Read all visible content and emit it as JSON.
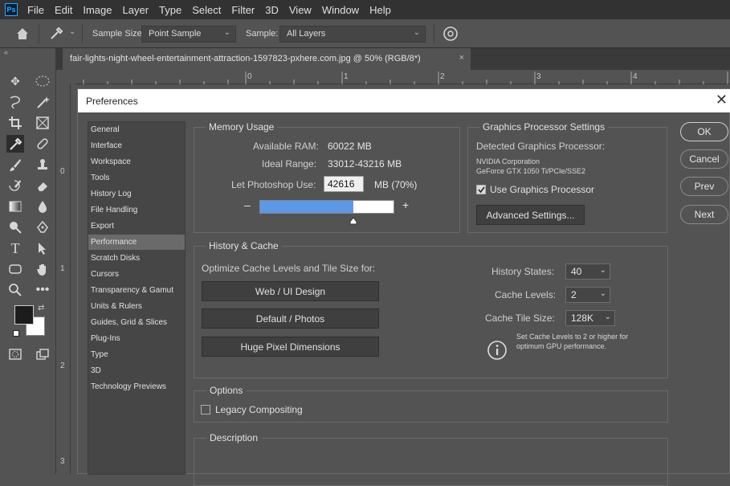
{
  "menubar": {
    "logo": "Ps",
    "items": [
      "File",
      "Edit",
      "Image",
      "Layer",
      "Type",
      "Select",
      "Filter",
      "3D",
      "View",
      "Window",
      "Help"
    ]
  },
  "options_bar": {
    "sample_size_label": "Sample Size:",
    "sample_size_value": "Point Sample",
    "sample_label": "Sample:",
    "sample_value": "All Layers"
  },
  "document_tab": {
    "title": "fair-lights-night-wheel-entertainment-attraction-1597823-pxhere.com.jpg @ 50% (RGB/8*)",
    "close": "×"
  },
  "rulers": {
    "horizontal": [
      "0",
      "1",
      "2",
      "3",
      "4"
    ],
    "vertical": [
      "0",
      "1",
      "2",
      "3"
    ]
  },
  "dialog": {
    "title": "Preferences",
    "close": "✕",
    "nav": [
      "General",
      "Interface",
      "Workspace",
      "Tools",
      "History Log",
      "File Handling",
      "Export",
      "Performance",
      "Scratch Disks",
      "Cursors",
      "Transparency & Gamut",
      "Units & Rulers",
      "Guides, Grid & Slices",
      "Plug-Ins",
      "Type",
      "3D",
      "Technology Previews"
    ],
    "selected_nav": "Performance",
    "memory": {
      "title": "Memory Usage",
      "available_label": "Available RAM:",
      "available_value": "60022 MB",
      "ideal_label": "Ideal Range:",
      "ideal_value": "33012-43216 MB",
      "let_label": "Let Photoshop Use:",
      "let_value": "42616",
      "let_suffix": "MB (70%)",
      "minus": "–",
      "plus": "+",
      "slider_fraction": 0.7
    },
    "gpu": {
      "title": "Graphics Processor Settings",
      "detected_label": "Detected Graphics Processor:",
      "vendor": "NVIDIA Corporation",
      "model": "GeForce GTX 1050 Ti/PCIe/SSE2",
      "use_label": "Use Graphics Processor",
      "use_checked": true,
      "advanced_button": "Advanced Settings..."
    },
    "history": {
      "title": "History & Cache",
      "optimize_label": "Optimize Cache Levels and Tile Size for:",
      "buttons": [
        "Web / UI Design",
        "Default / Photos",
        "Huge Pixel Dimensions"
      ],
      "states_label": "History States:",
      "states_value": "40",
      "levels_label": "Cache Levels:",
      "levels_value": "2",
      "tile_label": "Cache Tile Size:",
      "tile_value": "128K",
      "note_line1": "Set Cache Levels to 2 or higher for",
      "note_line2": "optimum GPU performance."
    },
    "options": {
      "title": "Options",
      "legacy_label": "Legacy Compositing",
      "legacy_checked": false
    },
    "description": {
      "title": "Description"
    },
    "side_buttons": [
      "OK",
      "Cancel",
      "Prev",
      "Next"
    ]
  }
}
